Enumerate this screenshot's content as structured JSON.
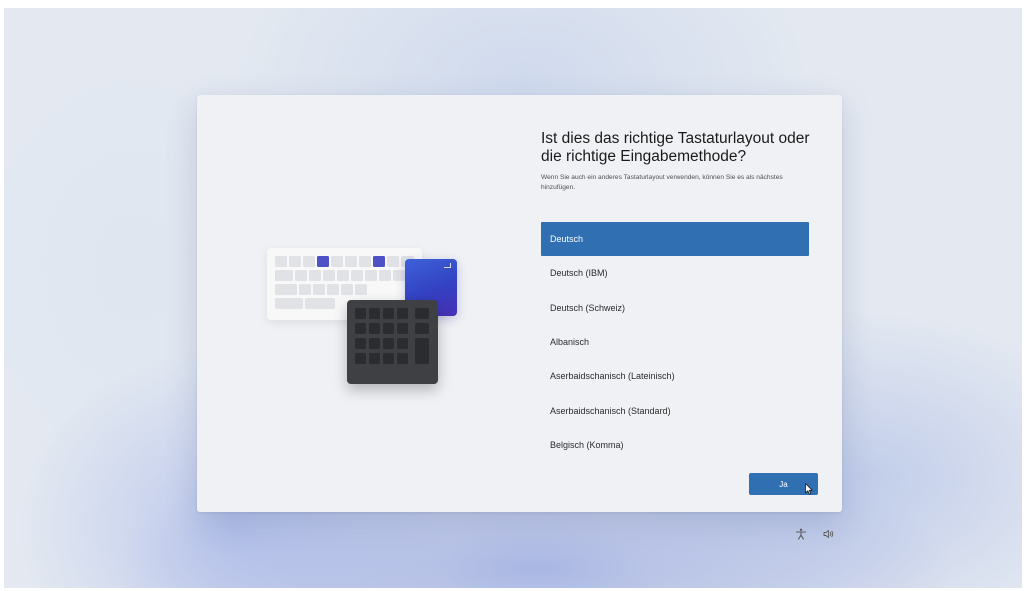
{
  "dialog": {
    "title": "Ist dies das richtige Tastaturlayout oder die richtige Eingabemethode?",
    "subtitle": "Wenn Sie auch ein anderes Tastaturlayout verwenden, können Sie es als nächstes hinzufügen.",
    "layouts": [
      {
        "label": "Deutsch",
        "selected": true
      },
      {
        "label": "Deutsch (IBM)",
        "selected": false
      },
      {
        "label": "Deutsch (Schweiz)",
        "selected": false
      },
      {
        "label": "Albanisch",
        "selected": false
      },
      {
        "label": "Aserbaidschanisch (Lateinisch)",
        "selected": false
      },
      {
        "label": "Aserbaidschanisch (Standard)",
        "selected": false
      },
      {
        "label": "Belgisch (Komma)",
        "selected": false
      }
    ],
    "confirm_label": "Ja"
  },
  "tray": {
    "icons": [
      "accessibility-icon",
      "volume-icon"
    ]
  },
  "colors": {
    "accent": "#2f6fb2",
    "illustration_accent": "#4c51c6",
    "dialog_bg": "#eff1f5"
  }
}
